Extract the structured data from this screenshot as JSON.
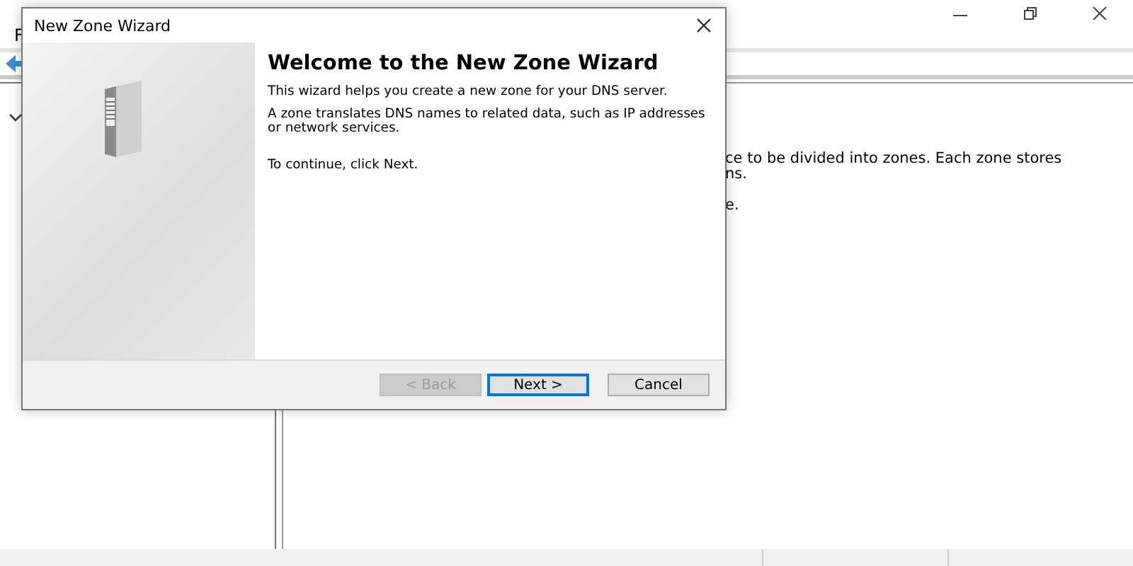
{
  "main_window": {
    "menu": [
      "F"
    ],
    "content_lines": [
      "ce to be divided into zones. Each zone stores",
      "ns.",
      "e."
    ]
  },
  "dialog": {
    "title": "New Zone Wizard",
    "heading": "Welcome to the New Zone Wizard",
    "paragraphs": [
      "This wizard helps you create a new zone for your DNS server.",
      "A zone translates DNS names to related data, such as IP addresses or network services.",
      "To continue, click Next."
    ],
    "buttons": [
      {
        "label": "< Back",
        "disabled": true,
        "default": false
      },
      {
        "label": "Next >",
        "disabled": false,
        "default": true
      },
      {
        "label": "Cancel",
        "disabled": false,
        "default": false
      }
    ]
  }
}
